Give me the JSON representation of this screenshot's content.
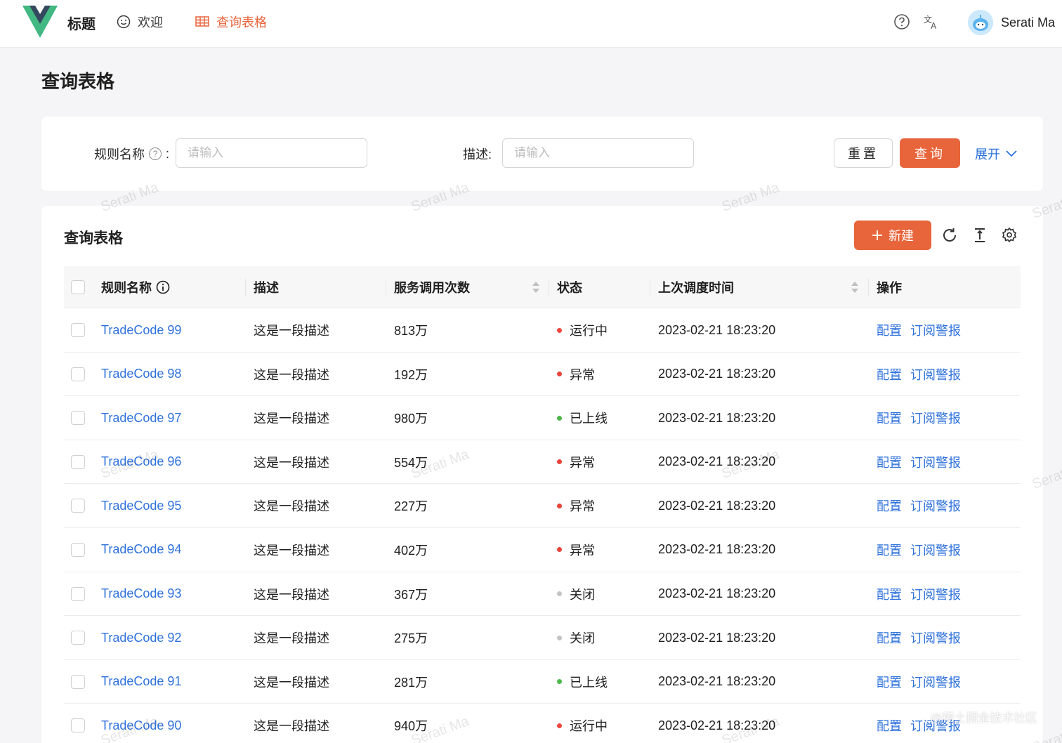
{
  "header": {
    "brand": "标题",
    "nav": [
      {
        "label": "欢迎",
        "icon": "smile-icon"
      },
      {
        "label": "查询表格",
        "icon": "table-icon",
        "active": true
      }
    ],
    "icons": [
      "help-icon",
      "translate-icon"
    ],
    "user": "Serati Ma",
    "accent_color": "#e8643b",
    "link_color": "#2f72dc"
  },
  "page": {
    "title": "查询表格"
  },
  "search": {
    "rule_label": "规则名称",
    "rule_colon": ":",
    "rule_placeholder": "请输入",
    "desc_label": "描述:",
    "desc_placeholder": "请输入",
    "reset_label": "重置",
    "query_label": "查询",
    "expand_label": "展开"
  },
  "table": {
    "title": "查询表格",
    "new_label": "新建",
    "columns": {
      "name": "规则名称",
      "desc": "描述",
      "calls": "服务调用次数",
      "status": "状态",
      "time": "上次调度时间",
      "ops": "操作"
    },
    "op_config": "配置",
    "op_subscribe": "订阅警报",
    "rows": [
      {
        "name": "TradeCode 99",
        "desc": "这是一段描述",
        "calls": "813万",
        "status": "运行中",
        "status_color": "#f0473f",
        "time": "2023-02-21 18:23:20"
      },
      {
        "name": "TradeCode 98",
        "desc": "这是一段描述",
        "calls": "192万",
        "status": "异常",
        "status_color": "#e8443c",
        "time": "2023-02-21 18:23:20"
      },
      {
        "name": "TradeCode 97",
        "desc": "这是一段描述",
        "calls": "980万",
        "status": "已上线",
        "status_color": "#4cb84a",
        "time": "2023-02-21 18:23:20"
      },
      {
        "name": "TradeCode 96",
        "desc": "这是一段描述",
        "calls": "554万",
        "status": "异常",
        "status_color": "#e8443c",
        "time": "2023-02-21 18:23:20"
      },
      {
        "name": "TradeCode 95",
        "desc": "这是一段描述",
        "calls": "227万",
        "status": "异常",
        "status_color": "#e8443c",
        "time": "2023-02-21 18:23:20"
      },
      {
        "name": "TradeCode 94",
        "desc": "这是一段描述",
        "calls": "402万",
        "status": "异常",
        "status_color": "#e8443c",
        "time": "2023-02-21 18:23:20"
      },
      {
        "name": "TradeCode 93",
        "desc": "这是一段描述",
        "calls": "367万",
        "status": "关闭",
        "status_color": "#c4c4c4",
        "time": "2023-02-21 18:23:20"
      },
      {
        "name": "TradeCode 92",
        "desc": "这是一段描述",
        "calls": "275万",
        "status": "关闭",
        "status_color": "#c4c4c4",
        "time": "2023-02-21 18:23:20"
      },
      {
        "name": "TradeCode 91",
        "desc": "这是一段描述",
        "calls": "281万",
        "status": "已上线",
        "status_color": "#4cb84a",
        "time": "2023-02-21 18:23:20"
      },
      {
        "name": "TradeCode 90",
        "desc": "这是一段描述",
        "calls": "940万",
        "status": "运行中",
        "status_color": "#f0473f",
        "time": "2023-02-21 18:23:20"
      }
    ]
  },
  "watermark": "Serati Ma",
  "footer_watermark": "@稀土掘金技术社区"
}
